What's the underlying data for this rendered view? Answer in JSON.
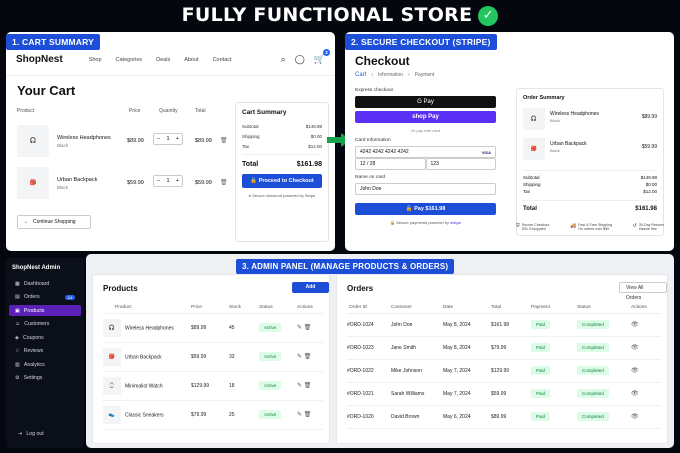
{
  "headline": "FULLY FUNCTIONAL STORE",
  "tags": {
    "cart": "1. CART SUMMARY",
    "checkout": "2. SECURE CHECKOUT (STRIPE)",
    "admin": "3. ADMIN PANEL (MANAGE PRODUCTS & ORDERS)"
  },
  "store": {
    "logo": "ShopNest",
    "nav": [
      "Shop",
      "Categories",
      "Deals",
      "About",
      "Contact"
    ],
    "cart_count": "2"
  },
  "cart": {
    "title": "Your Cart",
    "headers": {
      "product": "Product",
      "price": "Price",
      "quantity": "Quantity",
      "total": "Total"
    },
    "items": [
      {
        "name": "Wireless Headphones",
        "variant": "Black",
        "price": "$89.99",
        "qty": "1",
        "total": "$89.99"
      },
      {
        "name": "Urban Backpack",
        "variant": "Black",
        "price": "$59.99",
        "qty": "1",
        "total": "$59.99"
      }
    ],
    "continue": "Continue Shopping",
    "summary": {
      "title": "Cart Summary",
      "rows": [
        {
          "label": "Subtotal",
          "value": "$149.98"
        },
        {
          "label": "Shipping",
          "value": "$0.00"
        },
        {
          "label": "Tax",
          "value": "$12.00"
        }
      ],
      "total_label": "Total",
      "total_value": "$161.98",
      "button": "Proceed to Checkout",
      "secure": "Secure checkout powered by Stripe"
    }
  },
  "checkout": {
    "title": "Checkout",
    "crumbs": [
      "Cart",
      "Information",
      "Payment"
    ],
    "express": "Express checkout",
    "gpay": "G Pay",
    "shoppay": "shop Pay",
    "or": "Or pay with card",
    "card_label": "Card Information",
    "card_number": "4242 4242 4242 4242",
    "card_brand": "VISA",
    "expiry": "12 / 28",
    "cvc": "123",
    "name_label": "Name on card",
    "name_value": "John Doe",
    "pay_button": "Pay $161.98",
    "powered_prefix": "Secure payments powered by ",
    "powered_brand": "stripe",
    "summary": {
      "title": "Order Summary",
      "items": [
        {
          "name": "Wireless Headphones",
          "variant": "Black",
          "price": "$89.99"
        },
        {
          "name": "Urban Backpack",
          "variant": "Black",
          "price": "$59.99"
        }
      ],
      "rows": [
        {
          "label": "Subtotal",
          "value": "$149.98"
        },
        {
          "label": "Shipping",
          "value": "$0.00"
        },
        {
          "label": "Tax",
          "value": "$12.00"
        }
      ],
      "total_label": "Total",
      "total_value": "$161.98"
    },
    "badges": [
      {
        "title": "Secure Checkout",
        "sub": "SSL Encrypted"
      },
      {
        "title": "Fast & Free Shipping",
        "sub": "On orders over $50"
      },
      {
        "title": "30-Day Returns",
        "sub": "Hassle free"
      }
    ]
  },
  "admin": {
    "logo": "ShopNest Admin",
    "menu": [
      {
        "label": "Dashboard"
      },
      {
        "label": "Orders",
        "count": "24"
      },
      {
        "label": "Products"
      },
      {
        "label": "Customers"
      },
      {
        "label": "Coupons"
      },
      {
        "label": "Reviews"
      },
      {
        "label": "Analytics"
      },
      {
        "label": "Settings"
      }
    ],
    "logout": "Log out",
    "products": {
      "title": "Products",
      "add": "Add Product",
      "headers": [
        "Product",
        "Price",
        "Stock",
        "Status",
        "Actions"
      ],
      "rows": [
        {
          "name": "Wireless Headphones",
          "price": "$89.99",
          "stock": "45",
          "status": "Active"
        },
        {
          "name": "Urban Backpack",
          "price": "$59.99",
          "stock": "32",
          "status": "Active"
        },
        {
          "name": "Minimalist Watch",
          "price": "$129.99",
          "stock": "18",
          "status": "Active"
        },
        {
          "name": "Classic Sneakers",
          "price": "$79.99",
          "stock": "25",
          "status": "Active"
        }
      ]
    },
    "orders": {
      "title": "Orders",
      "view": "View All Orders",
      "headers": [
        "Order ID",
        "Customer",
        "Date",
        "Total",
        "Payment",
        "Status",
        "Actions"
      ],
      "rows": [
        {
          "id": "#ORD-1024",
          "customer": "John Doe",
          "date": "May 8, 2024",
          "total": "$161.98",
          "payment": "Paid",
          "status": "Completed"
        },
        {
          "id": "#ORD-1023",
          "customer": "Jane Smith",
          "date": "May 8, 2024",
          "total": "$79.99",
          "payment": "Paid",
          "status": "Completed"
        },
        {
          "id": "#ORD-1022",
          "customer": "Mike Johnson",
          "date": "May 7, 2024",
          "total": "$129.99",
          "payment": "Paid",
          "status": "Completed"
        },
        {
          "id": "#ORD-1021",
          "customer": "Sarah Williams",
          "date": "May 7, 2024",
          "total": "$59.99",
          "payment": "Paid",
          "status": "Completed"
        },
        {
          "id": "#ORD-1020",
          "customer": "David Brown",
          "date": "May 6, 2024",
          "total": "$89.99",
          "payment": "Paid",
          "status": "Completed"
        }
      ]
    }
  }
}
